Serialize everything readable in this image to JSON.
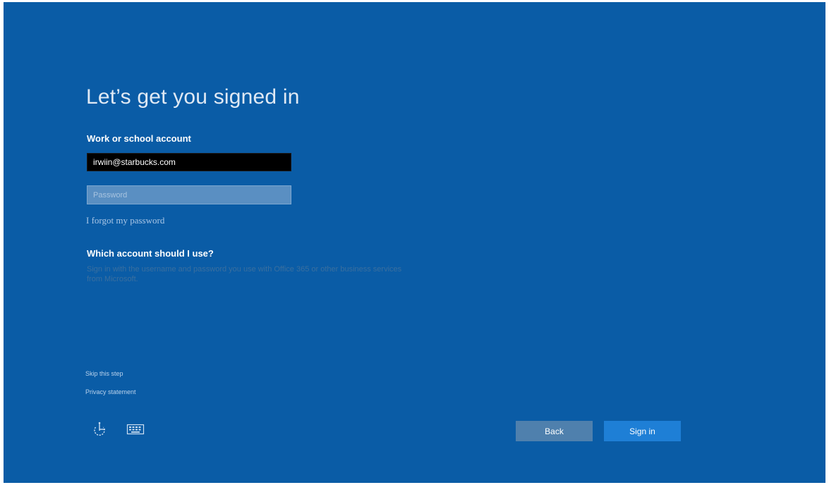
{
  "page": {
    "title": "Let’s get you signed in",
    "background_color": "#0a5ca6"
  },
  "account_field": {
    "label": "Work or school account",
    "value": "irwiin@starbucks.com"
  },
  "password_field": {
    "placeholder": "Password",
    "value": ""
  },
  "links": {
    "forgot_password": "I forgot my password",
    "skip_step": "Skip this step",
    "privacy": "Privacy statement"
  },
  "help": {
    "heading": "Which account should I use?",
    "body": "Sign in with the username and password you use with Office 365 or other business services from Microsoft."
  },
  "accessibility": {
    "ease_of_access_icon": "ease-of-access-icon",
    "keyboard_icon": "keyboard-icon"
  },
  "buttons": {
    "back": "Back",
    "sign_in": "Sign in",
    "back_color": "#4f80ad",
    "sign_in_color": "#1e7fd6"
  }
}
